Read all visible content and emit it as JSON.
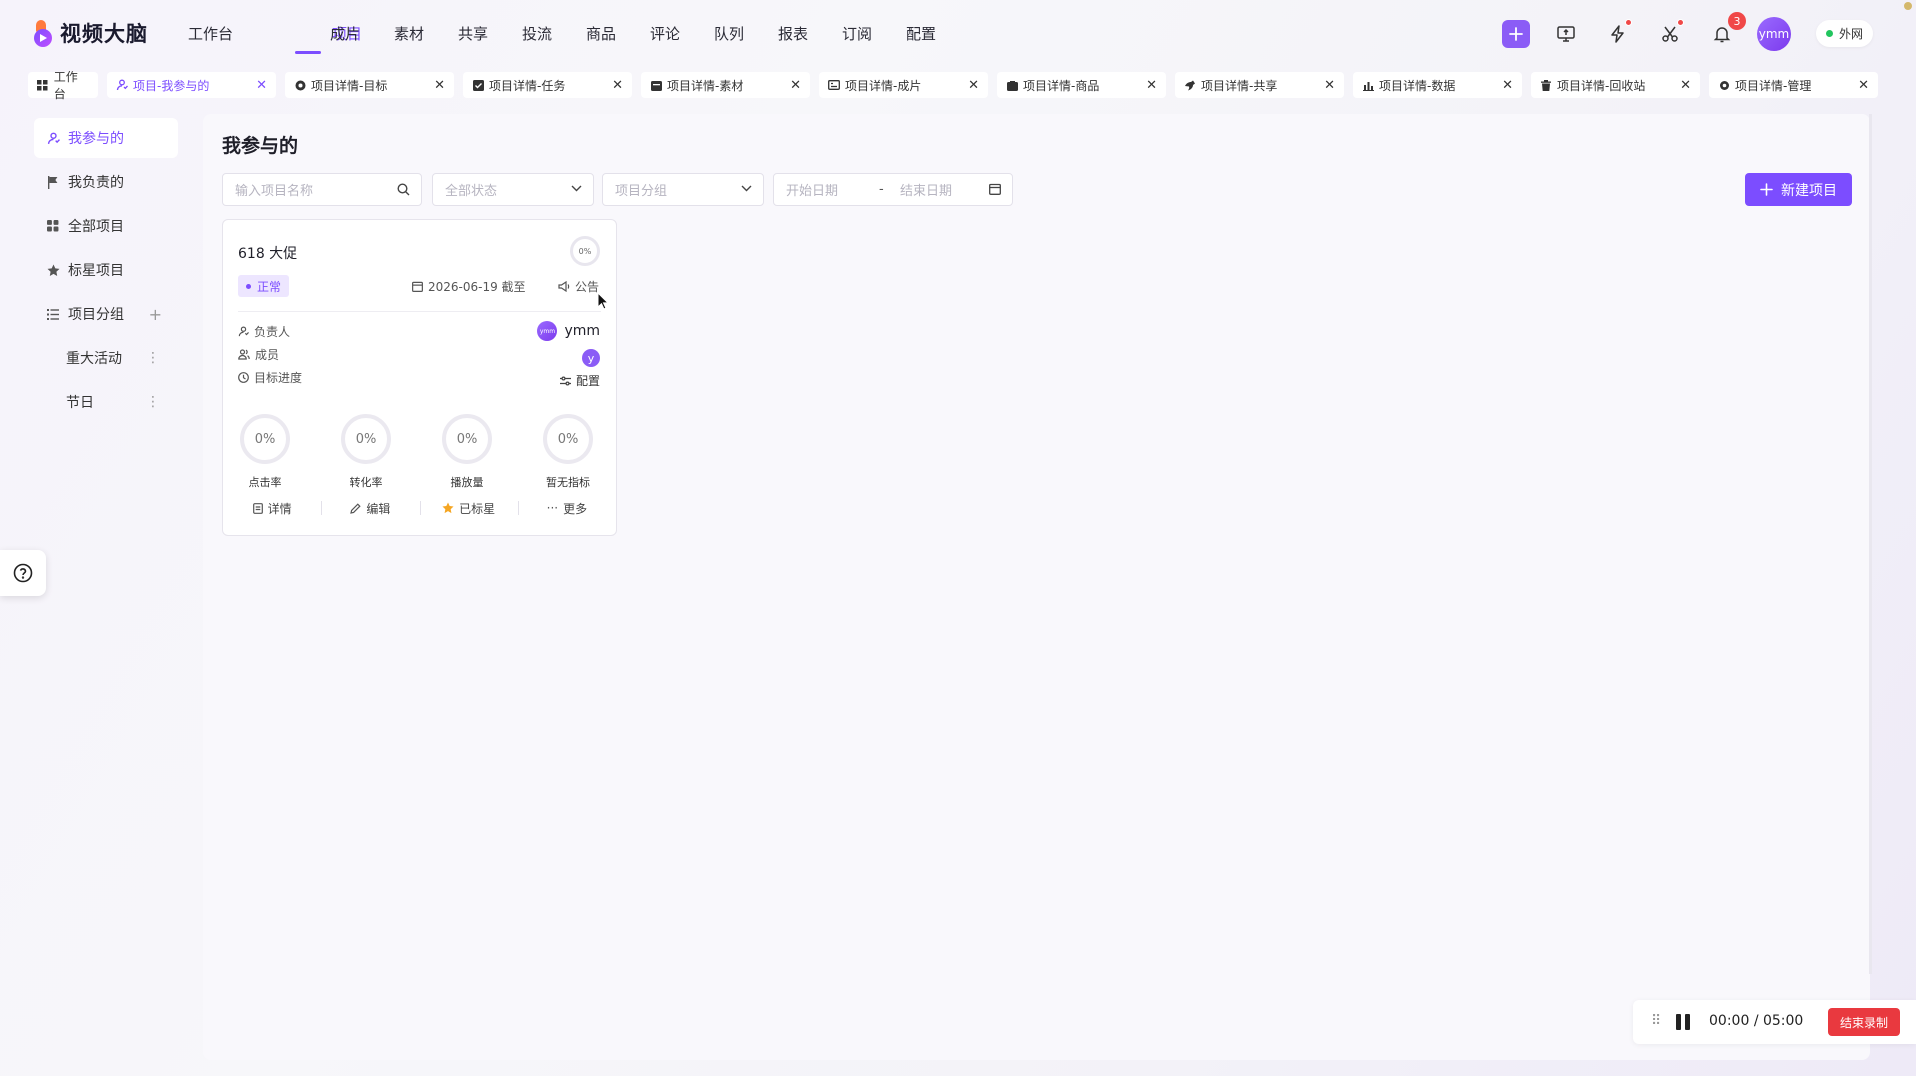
{
  "app": {
    "logo_text": "视频大脑",
    "accent_color": "#7c4dff"
  },
  "nav": {
    "items": [
      {
        "label": "工作台",
        "active": false
      },
      {
        "label": "项目",
        "active": true
      },
      {
        "label": "成片",
        "active": false
      },
      {
        "label": "素材",
        "active": false
      },
      {
        "label": "共享",
        "active": false
      },
      {
        "label": "投流",
        "active": false
      },
      {
        "label": "商品",
        "active": false
      },
      {
        "label": "评论",
        "active": false
      },
      {
        "label": "队列",
        "active": false
      },
      {
        "label": "报表",
        "active": false
      },
      {
        "label": "订阅",
        "active": false
      },
      {
        "label": "配置",
        "active": false
      }
    ]
  },
  "header": {
    "notification_count": "3",
    "user_avatar": "ymm",
    "network_label": "外网",
    "icons": [
      "plus-icon",
      "monitor-icon",
      "lightning-icon",
      "scissors-icon",
      "bell-icon"
    ]
  },
  "tabs": [
    {
      "label": "工作台",
      "icon": "grid-icon",
      "closable": false,
      "active": false
    },
    {
      "label": "项目-我参与的",
      "icon": "person-icon",
      "closable": true,
      "active": true
    },
    {
      "label": "项目详情-目标",
      "icon": "target-icon",
      "closable": true,
      "active": false
    },
    {
      "label": "项目详情-任务",
      "icon": "checkbox-icon",
      "closable": true,
      "active": false
    },
    {
      "label": "项目详情-素材",
      "icon": "folder-icon",
      "closable": true,
      "active": false
    },
    {
      "label": "项目详情-成片",
      "icon": "film-icon",
      "closable": true,
      "active": false
    },
    {
      "label": "项目详情-商品",
      "icon": "bag-icon",
      "closable": true,
      "active": false
    },
    {
      "label": "项目详情-共享",
      "icon": "share-icon",
      "closable": true,
      "active": false
    },
    {
      "label": "项目详情-数据",
      "icon": "chart-icon",
      "closable": true,
      "active": false
    },
    {
      "label": "项目详情-回收站",
      "icon": "trash-icon",
      "closable": true,
      "active": false
    },
    {
      "label": "项目详情-管理",
      "icon": "gear-icon",
      "closable": true,
      "active": false
    }
  ],
  "sidebar": {
    "items": [
      {
        "label": "我参与的",
        "icon": "person-icon",
        "active": true
      },
      {
        "label": "我负责的",
        "icon": "flag-icon",
        "active": false
      },
      {
        "label": "全部项目",
        "icon": "grid-icon",
        "active": false
      },
      {
        "label": "标星项目",
        "icon": "star-icon",
        "active": false
      },
      {
        "label": "项目分组",
        "icon": "list-icon",
        "active": false
      }
    ],
    "groups": [
      {
        "label": "重大活动"
      },
      {
        "label": "节日"
      }
    ]
  },
  "main": {
    "title": "我参与的",
    "filters": {
      "search_placeholder": "输入项目名称",
      "status_placeholder": "全部状态",
      "group_placeholder": "项目分组",
      "start_date_placeholder": "开始日期",
      "date_separator": "-",
      "end_date_placeholder": "结束日期"
    },
    "new_button_label": "新建项目"
  },
  "project_card": {
    "name": "618 大促",
    "overall_progress": "0%",
    "status": "正常",
    "deadline": "2026-06-19 截至",
    "notice_label": "公告",
    "owner_label": "负责人",
    "owner_name": "ymm",
    "owner_avatar": "ymm",
    "members_label": "成员",
    "member_avatar": "y",
    "goal_label": "目标进度",
    "config_label": "配置",
    "kpis": [
      {
        "label": "点击率",
        "value": "0%"
      },
      {
        "label": "转化率",
        "value": "0%"
      },
      {
        "label": "播放量",
        "value": "0%"
      },
      {
        "label": "暂无指标",
        "value": "0%"
      }
    ],
    "actions": [
      {
        "label": "详情",
        "icon": "document-icon"
      },
      {
        "label": "编辑",
        "icon": "pencil-icon"
      },
      {
        "label": "已标星",
        "icon": "star-icon"
      },
      {
        "label": "更多",
        "icon": "ellipsis-icon"
      }
    ]
  },
  "recording": {
    "elapsed": "00:00",
    "separator": "/",
    "total": "05:00",
    "stop_label": "结束录制"
  }
}
